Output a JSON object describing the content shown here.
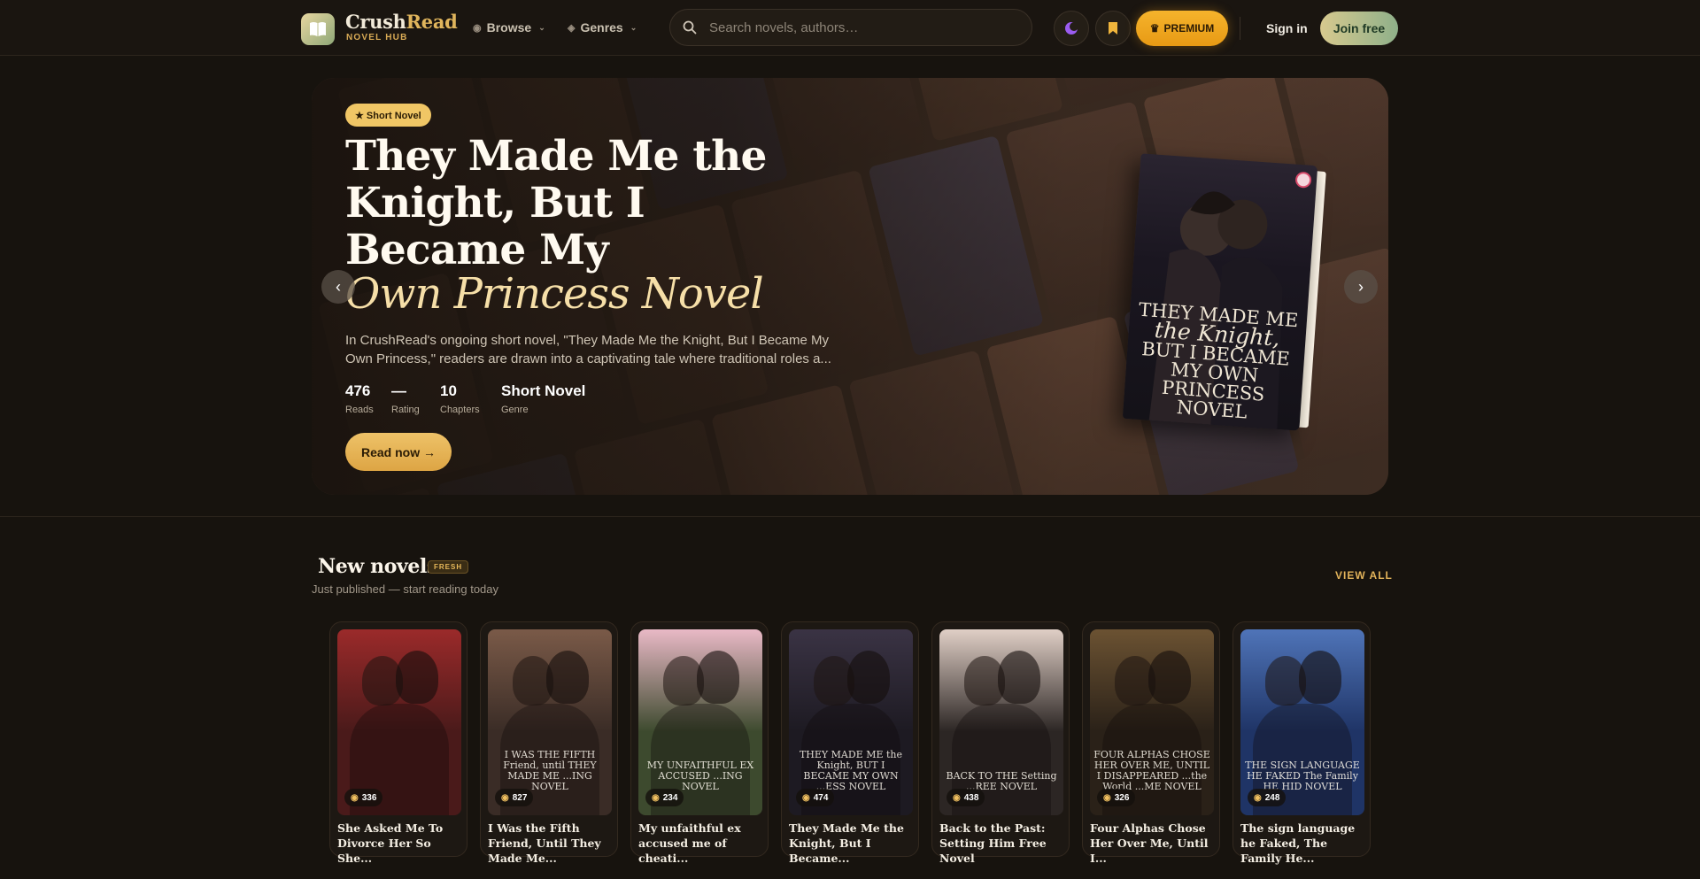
{
  "nav": {
    "brand_part1": "Crush",
    "brand_part2": "Read",
    "brand_sub": "NOVEL HUB",
    "browse": "Browse",
    "genres": "Genres",
    "search_placeholder": "Search novels, authors…",
    "premium": "PREMIUM",
    "signin": "Sign in",
    "joinfree": "Join free"
  },
  "hero": {
    "badge": "★ Short Novel",
    "title_line": "They Made Me the Knight, But I Became My",
    "title_italic": "Own Princess Novel",
    "description": "In CrushRead's ongoing short novel, \"They Made Me the Knight, But I Became My Own Princess,\" readers are drawn into a captivating tale where traditional roles a...",
    "stats": [
      {
        "value": "476",
        "label": "Reads"
      },
      {
        "value": "—",
        "label": "Rating"
      },
      {
        "value": "10",
        "label": "Chapters"
      },
      {
        "value": "Short Novel",
        "label": "Genre"
      }
    ],
    "read_now": "Read now →",
    "prev": "‹",
    "next": "›",
    "book_cover_line1": "THEY MADE ME",
    "book_cover_line2": "the Knight,",
    "book_cover_line3": "BUT I BECAME",
    "book_cover_line4": "MY OWN",
    "book_cover_line5": "PRINCESS NOVEL"
  },
  "new_novels": {
    "title": "New novels",
    "badge": "FRESH",
    "subtitle": "Just published — start reading today",
    "view_all": "VIEW ALL",
    "cards": [
      {
        "title": "She Asked Me To Divorce Her So She...",
        "reads": "336",
        "cover_text": "",
        "bg": "#4a1a1a",
        "accent": "#9b2a2a"
      },
      {
        "title": "I Was the Fifth Friend, Until They Made Me...",
        "reads": "827",
        "cover_text": "I WAS THE FIFTH Friend, until THEY MADE ME ...ING NOVEL",
        "bg": "#3a2c26",
        "accent": "#7a5a48"
      },
      {
        "title": "My unfaithful ex accused me of cheati...",
        "reads": "234",
        "cover_text": "MY UNFAITHFUL EX ACCUSED ...ING NOVEL",
        "bg": "#3d4a2e",
        "accent": "#e9b9c6"
      },
      {
        "title": "They Made Me the Knight, But I Became...",
        "reads": "474",
        "cover_text": "THEY MADE ME the Knight, BUT I BECAME MY OWN ...ESS NOVEL",
        "bg": "#1d1a22",
        "accent": "#3a3344"
      },
      {
        "title": "Back to the Past: Setting Him Free Novel",
        "reads": "438",
        "cover_text": "BACK TO THE Setting ...REE NOVEL",
        "bg": "#2c2624",
        "accent": "#e0cfc6"
      },
      {
        "title": "Four Alphas Chose Her Over Me, Until I...",
        "reads": "326",
        "cover_text": "FOUR ALPHAS CHOSE HER OVER ME, UNTIL I DISAPPEARED ...the World ...ME NOVEL",
        "bg": "#2a2118",
        "accent": "#6b5232"
      },
      {
        "title": "The sign language he Faked, The Family He...",
        "reads": "248",
        "cover_text": "THE SIGN LANGUAGE HE FAKED The Family HE HID NOVEL",
        "bg": "#1f3466",
        "accent": "#4f74b8"
      }
    ]
  },
  "colors": {
    "accent_gold": "#e0b55c",
    "premium_orange": "#f0a51e",
    "background": "#17130e"
  }
}
